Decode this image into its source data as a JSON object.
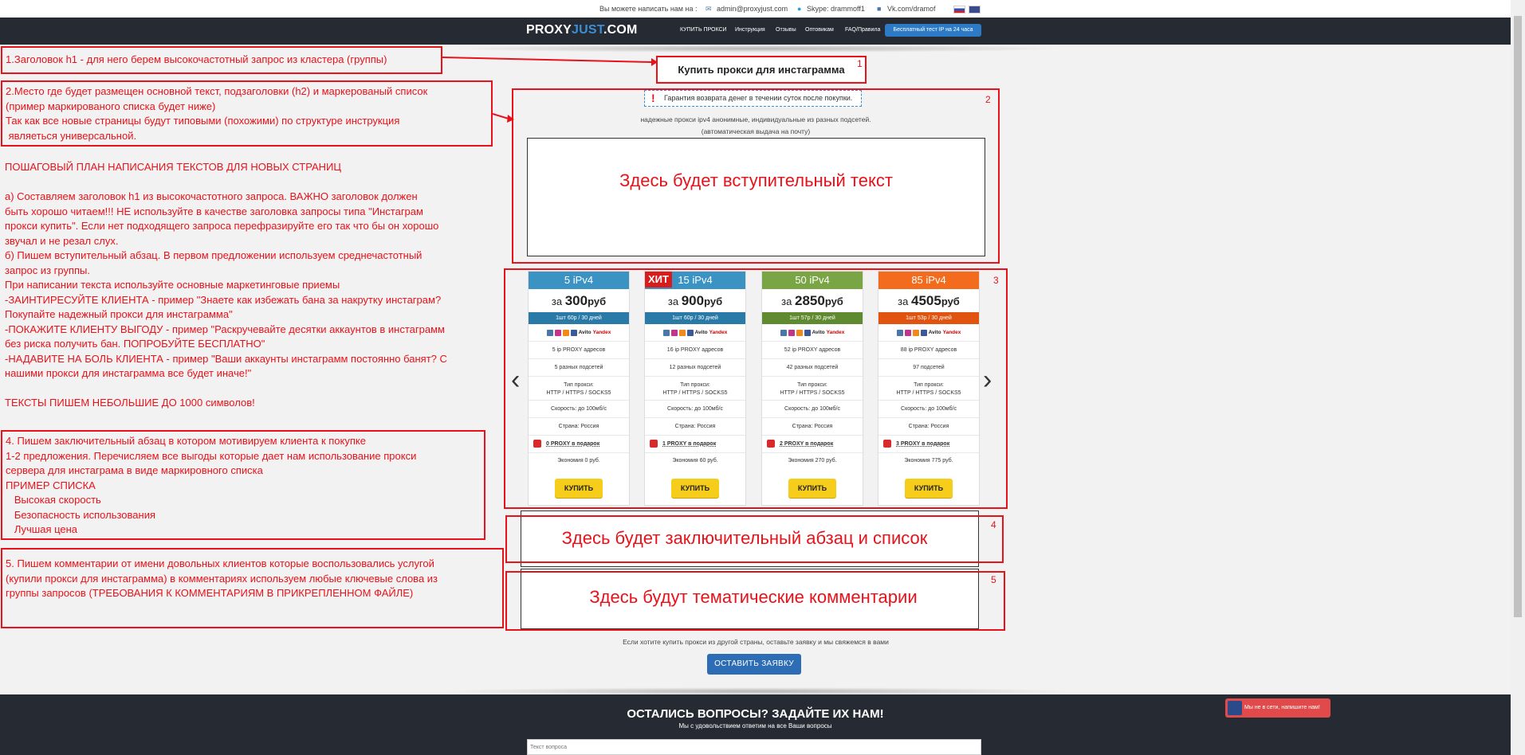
{
  "topbar": {
    "write_us": "Вы можете написать нам на :",
    "email": "admin@proxyjust.com",
    "skype": "Skype: drammoff1",
    "vk": "Vk.com/dramof"
  },
  "nav": {
    "logo_a": "PROXY",
    "logo_b": "JUST",
    "logo_c": ".COM",
    "links": [
      "КУПИТЬ ПРОКСИ",
      "Инструкция",
      "Отзывы",
      "Оптовикам",
      "FAQ/Правила"
    ],
    "trial": "Бесплатный тест IP на 24 часа"
  },
  "annotations": {
    "a1": "1.Заголовок h1 - для него берем высокочастотный запрос из кластера (группы)",
    "a2": "2.Место где будет размещен основной текст, подзаголовки (h2) и маркерованый список\n(пример маркированого списка будет ниже)\nТак как все новые страницы будут типовыми (похожими) по структуре инструкция\n являеться универсальной.",
    "plan": "ПОШАГОВЫЙ ПЛАН НАПИСАНИЯ ТЕКСТОВ ДЛЯ НОВЫХ СТРАНИЦ\n\nа) Составляем заголовок h1 из высокочастотного запроса. ВАЖНО заголовок должен\nбыть хорошо читаем!!! НЕ используйте в качестве заголовка запросы типа \"Инстаграм\nпрокси купить\". Если нет подходящего запроса перефразируйте его так что бы он хорошо\nзвучал и не резал слух.\nб) Пишем вступительный абзац. В первом предложении используем среднечастотный\nзапрос из группы.\nПри написании текста используйте основные маркетинговые приемы\n-ЗАИНТИРЕСУЙТЕ КЛИЕНТА - пример \"Знаете как избежать бана за накрутку инстаграм?\nПокупайте надежный прокси для инстаграмма\"\n-ПОКАЖИТЕ КЛИЕНТУ ВЫГОДУ - пример \"Раскручевайте десятки аккаунтов в инстаграмм\nбез риска получить бан. ПОПРОБУЙТЕ БЕСПЛАТНО\"\n-НАДАВИТЕ НА БОЛЬ КЛИЕНТА - пример \"Ваши аккаунты инстаграмм постоянно банят? С\nнашими прокси для инстаграмма все будет иначе!\"\n\nТЕКСТЫ ПИШЕМ НЕБОЛЬШИЕ ДО 1000 символов!",
    "a4": "4. Пишем заключительный абзац в котором мотивируем клиента к покупке\n1-2 предложения. Перечисляем все выгоды которые дает нам использование прокси\nсервера для инстаграма в виде маркировного списка\nПРИМЕР СПИСКА\n   Высокая скорость\n   Безопасность использования\n   Лучшая цена",
    "a5": "5. Пишем комментарии от имени довольных клиентов которые воспользовались услугой\n(купили прокси для инстаграмма) в комментариях используем любые ключевые слова из\nгруппы запросов (ТРЕБОВАНИЯ К КОММЕНТАРИЯМ В ПРИКРЕПЛЕННОМ ФАЙЛЕ)",
    "n1": "1",
    "n2": "2",
    "n3": "3",
    "n4": "4",
    "n5": "5"
  },
  "main": {
    "h1": "Купить прокси для инстаграмма",
    "guarantee": "Гарантия возврата денег в течении суток после покупки.",
    "sub1": "надежные прокси ipv4 анонимные, индивидуальные из разных подсетей.",
    "sub2": "(автоматическая выдача на почту)",
    "intro": "Здесь будет вступительный текст",
    "closing": "Здесь будет заключительный абзац и список",
    "comments": "Здесь будут тематические комментарии",
    "other_country": "Если хотите купить прокси из другой страны, оставьте заявку и мы свяжемся в вами",
    "request_btn": "ОСТАВИТЬ ЗАЯВКУ"
  },
  "cards": [
    {
      "title": "5 iPv4",
      "za": "за",
      "price": "300",
      "cur": "руб",
      "per": "1шт 60р / 30 дней",
      "ips": "5 ip PROXY адресов",
      "subnets": "5 разных подсетей",
      "type_label": "Тип прокси:",
      "type": "HTTP / HTTPS / SOCKS5",
      "speed": "Скорость: до 100мб/с",
      "country": "Страна: Россия",
      "gift": "0 PROXY в подарок",
      "save": "Экономия 0 руб.",
      "buy": "КУПИТЬ",
      "color": "#3b93c4",
      "dark": "#2a7aa8",
      "hit": ""
    },
    {
      "title": "15 iPv4",
      "za": "за",
      "price": "900",
      "cur": "руб",
      "per": "1шт 60р / 30 дней",
      "ips": "16 ip PROXY адресов",
      "subnets": "12 разных подсетей",
      "type_label": "Тип прокси:",
      "type": "HTTP / HTTPS / SOCKS5",
      "speed": "Скорость: до 100мб/с",
      "country": "Страна: Россия",
      "gift": "1 PROXY в подарок",
      "save": "Экономия 60 руб.",
      "buy": "КУПИТЬ",
      "color": "#3b93c4",
      "dark": "#2a7aa8",
      "hit": "ХИТ"
    },
    {
      "title": "50 iPv4",
      "za": "за",
      "price": "2850",
      "cur": "руб",
      "per": "1шт 57р / 30 дней",
      "ips": "52 ip PROXY адресов",
      "subnets": "42 разных подсетей",
      "type_label": "Тип прокси:",
      "type": "HTTP / HTTPS / SOCKS5",
      "speed": "Скорость: до 100мб/с",
      "country": "Страна: Россия",
      "gift": "2 PROXY в подарок",
      "save": "Экономия 270 руб.",
      "buy": "КУПИТЬ",
      "color": "#79a544",
      "dark": "#5f8a30",
      "hit": ""
    },
    {
      "title": "85 iPv4",
      "za": "за",
      "price": "4505",
      "cur": "руб",
      "per": "1шт 53р / 30 дней",
      "ips": "88 ip PROXY адресов",
      "subnets": "97 подсетей",
      "type_label": "Тип прокси:",
      "type": "HTTP / HTTPS / SOCKS5",
      "speed": "Скорость: до 100мб/с",
      "country": "Страна: Россия",
      "gift": "3 PROXY в подарок",
      "save": "Экономия 775 руб.",
      "buy": "КУПИТЬ",
      "color": "#f36c1e",
      "dark": "#e05410",
      "hit": ""
    }
  ],
  "social_labels": {
    "avito": "Avito",
    "yandex": "Yandex"
  },
  "footer": {
    "title": "ОСТАЛИСЬ ВОПРОСЫ? ЗАДАЙТЕ ИХ НАМ!",
    "sub": "Мы с удовольствием ответим на все Ваши вопросы",
    "placeholder": "Текст вопроса",
    "chat": "Мы не в сети, напишите нам!"
  }
}
